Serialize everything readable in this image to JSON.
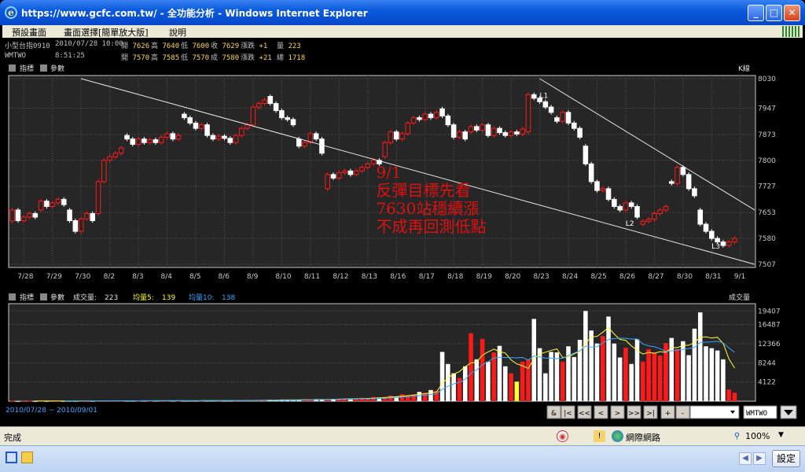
{
  "window": {
    "title": "https://www.gcfc.com.tw/ - 全功能分析 - Windows Internet Explorer",
    "minimize": "_",
    "maximize": "□",
    "close": "✕"
  },
  "menu": {
    "items": [
      "預設畫面",
      "畫面選擇[簡單放大版]",
      "說明"
    ]
  },
  "quotes": [
    {
      "name": "小型台指0910",
      "time": "2010/07/28 10:00",
      "l1": "開",
      "v1": "7626",
      "l2": "高",
      "v2": "7640",
      "l3": "低",
      "v3": "7600",
      "l4": "收",
      "v4": "7629",
      "l5": "漲跌",
      "v5": "+1",
      "l6": "量",
      "v6": "223"
    },
    {
      "name": "WMTWO",
      "time": "8:51:25",
      "l1": "開",
      "v1": "7570",
      "l2": "高",
      "v2": "7585",
      "l3": "低",
      "v3": "7570",
      "l4": "成",
      "v4": "7580",
      "l5": "漲跌",
      "v5": "+21",
      "l6": "總",
      "v6": "1718"
    }
  ],
  "toolbar": {
    "indicator": "指標",
    "params": "參數",
    "kline": "K線",
    "vol_label": "成交量:",
    "vol_value": "223",
    "ma5_label": "均量5:",
    "ma5_value": "139",
    "ma10_label": "均量10:",
    "ma10_value": "138",
    "vol_tag": "成交量",
    "range": "2010/07/28 ~ 2010/09/01",
    "nav": [
      "&",
      "|<",
      "<<",
      "<",
      ">",
      ">>",
      ">|",
      "+",
      "-"
    ],
    "symbol": "WMTWO"
  },
  "chart_data": {
    "type": "candlestick",
    "y_ticks": [
      7507,
      7580,
      7653,
      7727,
      7800,
      7873,
      7947,
      8030
    ],
    "ylim": [
      7507,
      8030
    ],
    "x_ticks": [
      "7/28",
      "7/29",
      "7/30",
      "8/2",
      "8/3",
      "8/4",
      "8/5",
      "8/6",
      "8/9",
      "8/10",
      "8/11",
      "8/12",
      "8/13",
      "8/16",
      "8/17",
      "8/18",
      "8/19",
      "8/20",
      "8/23",
      "8/24",
      "8/25",
      "8/26",
      "8/27",
      "8/30",
      "8/31",
      "9/1"
    ],
    "days": [
      {
        "d": "7/28",
        "bars": [
          [
            7629,
            7660
          ],
          [
            7660,
            7630
          ],
          [
            7630,
            7640
          ],
          [
            7640,
            7650
          ],
          [
            7650,
            7640
          ]
        ]
      },
      {
        "d": "7/29",
        "bars": [
          [
            7660,
            7685
          ],
          [
            7685,
            7670
          ],
          [
            7670,
            7680
          ],
          [
            7680,
            7690
          ],
          [
            7690,
            7675
          ]
        ]
      },
      {
        "d": "7/30",
        "bars": [
          [
            7660,
            7630
          ],
          [
            7630,
            7600
          ],
          [
            7600,
            7635
          ],
          [
            7635,
            7650
          ],
          [
            7650,
            7630
          ]
        ]
      },
      {
        "d": "8/2",
        "bars": [
          [
            7650,
            7740
          ],
          [
            7740,
            7800
          ],
          [
            7800,
            7810
          ],
          [
            7810,
            7820
          ],
          [
            7820,
            7835
          ]
        ]
      },
      {
        "d": "8/3",
        "bars": [
          [
            7870,
            7860
          ],
          [
            7860,
            7845
          ],
          [
            7845,
            7860
          ],
          [
            7860,
            7850
          ],
          [
            7850,
            7858
          ]
        ]
      },
      {
        "d": "8/4",
        "bars": [
          [
            7858,
            7850
          ],
          [
            7850,
            7865
          ],
          [
            7865,
            7875
          ],
          [
            7875,
            7860
          ],
          [
            7860,
            7870
          ]
        ]
      },
      {
        "d": "8/5",
        "bars": [
          [
            7930,
            7920
          ],
          [
            7920,
            7905
          ],
          [
            7905,
            7890
          ],
          [
            7890,
            7900
          ],
          [
            7900,
            7870
          ]
        ]
      },
      {
        "d": "8/6",
        "bars": [
          [
            7870,
            7860
          ],
          [
            7860,
            7868
          ],
          [
            7868,
            7862
          ],
          [
            7862,
            7850
          ],
          [
            7850,
            7870
          ]
        ]
      },
      {
        "d": "8/9",
        "bars": [
          [
            7870,
            7890
          ],
          [
            7890,
            7900
          ],
          [
            7900,
            7950
          ],
          [
            7950,
            7960
          ],
          [
            7960,
            7970
          ]
        ]
      },
      {
        "d": "8/10",
        "bars": [
          [
            7980,
            7960
          ],
          [
            7960,
            7940
          ],
          [
            7940,
            7920
          ],
          [
            7920,
            7915
          ],
          [
            7915,
            7900
          ]
        ]
      },
      {
        "d": "8/11",
        "bars": [
          [
            7860,
            7840
          ],
          [
            7840,
            7850
          ],
          [
            7850,
            7875
          ],
          [
            7875,
            7860
          ],
          [
            7860,
            7820
          ]
        ]
      },
      {
        "d": "8/12",
        "bars": [
          [
            7720,
            7760
          ],
          [
            7760,
            7750
          ],
          [
            7750,
            7765
          ],
          [
            7765,
            7770
          ],
          [
            7770,
            7760
          ]
        ]
      },
      {
        "d": "8/13",
        "bars": [
          [
            7760,
            7770
          ],
          [
            7770,
            7780
          ],
          [
            7780,
            7790
          ],
          [
            7790,
            7800
          ],
          [
            7800,
            7790
          ]
        ]
      },
      {
        "d": "8/16",
        "bars": [
          [
            7810,
            7850
          ],
          [
            7850,
            7880
          ],
          [
            7880,
            7860
          ],
          [
            7860,
            7875
          ],
          [
            7875,
            7905
          ]
        ]
      },
      {
        "d": "8/17",
        "bars": [
          [
            7905,
            7920
          ],
          [
            7920,
            7915
          ],
          [
            7915,
            7930
          ],
          [
            7930,
            7920
          ],
          [
            7920,
            7935
          ]
        ]
      },
      {
        "d": "8/18",
        "bars": [
          [
            7945,
            7925
          ],
          [
            7925,
            7900
          ],
          [
            7900,
            7865
          ],
          [
            7865,
            7880
          ],
          [
            7880,
            7860
          ]
        ]
      },
      {
        "d": "8/19",
        "bars": [
          [
            7880,
            7895
          ],
          [
            7895,
            7885
          ],
          [
            7885,
            7900
          ],
          [
            7900,
            7870
          ],
          [
            7870,
            7890
          ]
        ]
      },
      {
        "d": "8/20",
        "bars": [
          [
            7890,
            7878
          ],
          [
            7878,
            7870
          ],
          [
            7870,
            7880
          ],
          [
            7880,
            7874
          ],
          [
            7874,
            7888
          ]
        ]
      },
      {
        "d": "8/23",
        "bars": [
          [
            7880,
            7985
          ],
          [
            7985,
            7975
          ],
          [
            7975,
            7965
          ],
          [
            7965,
            7950
          ],
          [
            7950,
            7935
          ]
        ]
      },
      {
        "d": "8/24",
        "bars": [
          [
            7920,
            7910
          ],
          [
            7910,
            7935
          ],
          [
            7935,
            7905
          ],
          [
            7905,
            7890
          ],
          [
            7890,
            7865
          ]
        ]
      },
      {
        "d": "8/25",
        "bars": [
          [
            7840,
            7790
          ],
          [
            7790,
            7740
          ],
          [
            7740,
            7715
          ],
          [
            7715,
            7720
          ],
          [
            7720,
            7690
          ]
        ]
      },
      {
        "d": "8/26",
        "bars": [
          [
            7690,
            7670
          ],
          [
            7670,
            7660
          ],
          [
            7660,
            7680
          ],
          [
            7680,
            7670
          ],
          [
            7670,
            7640
          ]
        ]
      },
      {
        "d": "8/27",
        "bars": [
          [
            7620,
            7628
          ],
          [
            7628,
            7634
          ],
          [
            7634,
            7650
          ],
          [
            7650,
            7660
          ],
          [
            7660,
            7670
          ]
        ]
      },
      {
        "d": "8/30",
        "bars": [
          [
            7740,
            7735
          ],
          [
            7735,
            7780
          ],
          [
            7780,
            7760
          ],
          [
            7760,
            7720
          ],
          [
            7720,
            7700
          ]
        ]
      },
      {
        "d": "8/31",
        "bars": [
          [
            7660,
            7620
          ],
          [
            7620,
            7600
          ],
          [
            7600,
            7580
          ],
          [
            7580,
            7570
          ],
          [
            7570,
            7560
          ]
        ]
      },
      {
        "d": "9/1",
        "bars": [
          [
            7560,
            7570
          ],
          [
            7570,
            7580
          ]
        ]
      }
    ],
    "trendlines": [
      {
        "from": [
          "7/30",
          8030
        ],
        "to": [
          "9/1",
          7507
        ]
      },
      {
        "from": [
          "8/23",
          8030
        ],
        "to": [
          "9/1",
          7660
        ]
      }
    ],
    "point_labels": [
      {
        "text": "L1",
        "at": [
          "8/23",
          7985
        ]
      },
      {
        "text": "L2",
        "at": [
          "8/26",
          7625
        ]
      },
      {
        "text": "L3",
        "at": [
          "8/31",
          7560
        ]
      }
    ],
    "annotation": [
      "9/1",
      "反彈目標先看",
      "7630站穩續漲",
      "不成再回測低點"
    ],
    "annotation_color": "#e01010",
    "volume": {
      "y_ticks": [
        4122,
        8244,
        12366,
        16487,
        19407
      ],
      "ylim": [
        0,
        20300
      ],
      "days": [
        {
          "d": "7/28",
          "v": [
            50,
            40,
            30,
            60,
            40
          ]
        },
        {
          "d": "7/29",
          "v": [
            60,
            50,
            40,
            70,
            50
          ]
        },
        {
          "d": "7/30",
          "v": [
            60,
            50,
            70,
            40,
            50
          ]
        },
        {
          "d": "8/2",
          "v": [
            80,
            90,
            70,
            100,
            90
          ]
        },
        {
          "d": "8/3",
          "v": [
            90,
            80,
            100,
            120,
            90
          ]
        },
        {
          "d": "8/4",
          "v": [
            100,
            120,
            90,
            110,
            100
          ]
        },
        {
          "d": "8/5",
          "v": [
            100,
            120,
            110,
            130,
            100
          ]
        },
        {
          "d": "8/6",
          "v": [
            120,
            150,
            100,
            130,
            140
          ]
        },
        {
          "d": "8/9",
          "v": [
            150,
            200,
            180,
            250,
            220
          ]
        },
        {
          "d": "8/10",
          "v": [
            300,
            250,
            350,
            300,
            280
          ]
        },
        {
          "d": "8/11",
          "v": [
            350,
            400,
            300,
            450,
            380
          ]
        },
        {
          "d": "8/12",
          "v": [
            400,
            500,
            450,
            600,
            550
          ]
        },
        {
          "d": "8/13",
          "v": [
            500,
            700,
            600,
            900,
            800
          ]
        },
        {
          "d": "8/16",
          "v": [
            900,
            1200,
            1000,
            1500,
            1300
          ]
        },
        {
          "d": "8/17",
          "v": [
            1500,
            2000,
            1800,
            2400,
            2200
          ]
        },
        {
          "d": "8/18",
          "v": [
            10600,
            8000,
            6000,
            5000,
            7500
          ]
        },
        {
          "d": "8/19",
          "v": [
            14600,
            9000,
            13400,
            8500,
            10500
          ]
        },
        {
          "d": "8/20",
          "v": [
            11900,
            7500,
            6000,
            4200,
            8500
          ]
        },
        {
          "d": "8/23",
          "v": [
            9000,
            17700,
            11400,
            6000,
            10600
          ]
        },
        {
          "d": "8/24",
          "v": [
            10500,
            8500,
            11800,
            9500,
            13200
          ]
        },
        {
          "d": "8/25",
          "v": [
            19400,
            15200,
            12400,
            14000,
            18200
          ]
        },
        {
          "d": "8/26",
          "v": [
            12400,
            9400,
            11500,
            8000,
            13300
          ]
        },
        {
          "d": "8/27",
          "v": [
            8500,
            11200,
            10500,
            9800,
            12500
          ]
        },
        {
          "d": "8/30",
          "v": [
            13600,
            11200,
            12900,
            9900,
            15600
          ]
        },
        {
          "d": "8/31",
          "v": [
            19100,
            11800,
            11400,
            10900,
            9000
          ]
        },
        {
          "d": "9/1",
          "v": [
            2500,
            1800
          ]
        }
      ],
      "ma5_color": "#ffff33",
      "ma10_color": "#3aa6ff"
    },
    "colors": {
      "up": "#ff1a1a",
      "down": "#ffffff",
      "grid": "#555555",
      "trend": "#e8e8e8",
      "axis": "#c8c8c8",
      "highlight_vol": "#ffff33"
    }
  },
  "status": {
    "text": "完成",
    "zone": "網際網路",
    "zoom": "100%"
  },
  "taskbar": {
    "settings": "設定"
  }
}
